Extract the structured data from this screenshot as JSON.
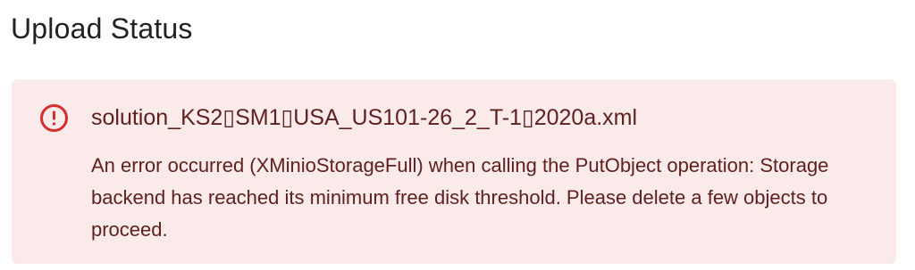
{
  "page": {
    "title": "Upload Status"
  },
  "alert": {
    "severity": "error",
    "icon": "error-outline-icon",
    "title": "solution_KS2▯SM1▯USA_US101-26_2_T-1▯2020a.xml",
    "message": "An error occurred (XMinioStorageFull) when calling the PutObject operation: Storage backend has reached its minimum free disk threshold. Please delete a few objects to proceed.",
    "colors": {
      "background": "#fbeaea",
      "text": "#5f2120",
      "icon": "#d32f2f"
    }
  }
}
